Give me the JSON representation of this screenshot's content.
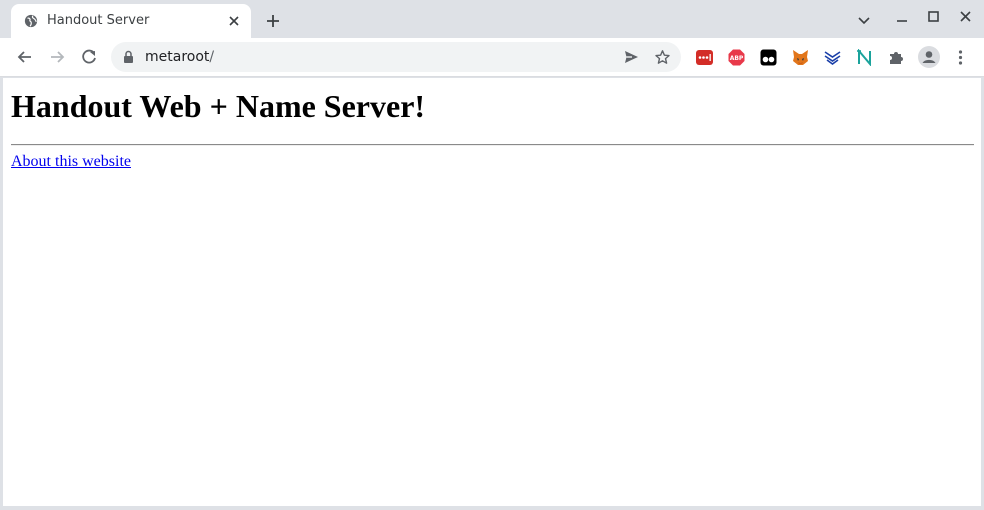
{
  "tab": {
    "title": "Handout Server"
  },
  "toolbar": {
    "url_host": "metaroot",
    "url_path": "/"
  },
  "page": {
    "heading": "Handout Web + Name Server!",
    "link_text": "About this website"
  },
  "extensions": [
    {
      "icon": "lastpass-icon",
      "color": "#d32d27"
    },
    {
      "icon": "adblock-plus-icon",
      "color": "#e8394a",
      "text": "ABP"
    },
    {
      "icon": "tampermonkey-icon",
      "color": "#000000"
    },
    {
      "icon": "metamask-icon",
      "color": "#e2761b"
    },
    {
      "icon": "readwise-icon",
      "color": "#1a3fa8"
    },
    {
      "icon": "notion-n-icon",
      "color": "#1ba39c"
    },
    {
      "icon": "puzzle-extensions-icon",
      "color": "#5f6368"
    },
    {
      "icon": "profile-avatar-icon",
      "color": "#5f6368"
    },
    {
      "icon": "kebab-menu-icon",
      "color": "#5f6368"
    }
  ],
  "colors": {
    "chrome_frame": "#dee1e6",
    "link": "#0000ee"
  }
}
